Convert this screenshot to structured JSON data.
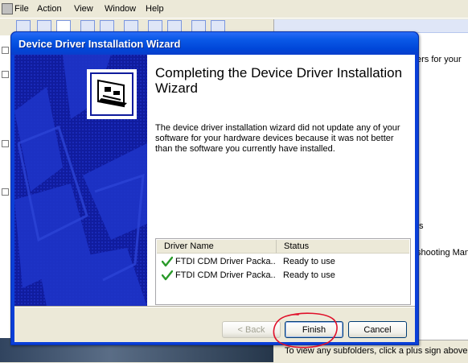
{
  "menu": {
    "items": [
      "File",
      "Action",
      "View",
      "Window",
      "Help"
    ]
  },
  "right_pane": {
    "lines": [
      "ers for your",
      "ts",
      "shooting Man"
    ],
    "status_text": "To view any subfolders, click a plus sign above."
  },
  "dialog": {
    "title": "Device Driver Installation Wizard",
    "heading": "Completing the Device Driver Installation Wizard",
    "description": "The device driver installation wizard did not update any of your software for your hardware devices because it was not better than the software you currently have installed.",
    "table": {
      "columns": [
        "Driver Name",
        "Status"
      ],
      "rows": [
        {
          "name": "FTDI CDM Driver Packa...",
          "status": "Ready to use"
        },
        {
          "name": "FTDI CDM Driver Packa...",
          "status": "Ready to use"
        }
      ]
    },
    "buttons": {
      "back": "< Back",
      "finish": "Finish",
      "cancel": "Cancel"
    }
  },
  "colors": {
    "title_blue": "#0046d8",
    "sidebar_blue": "#0f1b9c",
    "check_green": "#2a9a2a",
    "annotation_red": "#e0102a"
  }
}
